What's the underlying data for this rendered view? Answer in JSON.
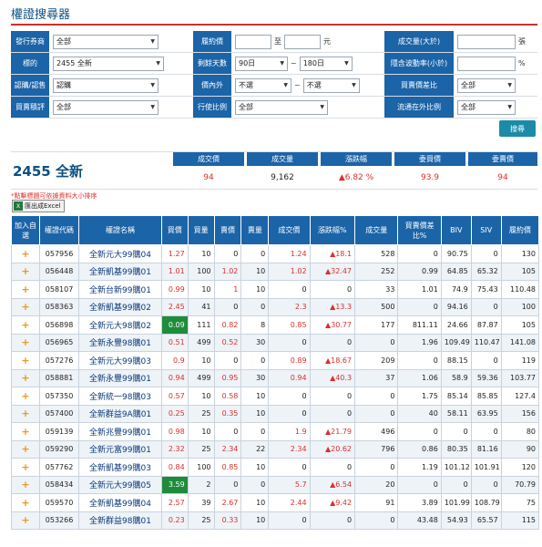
{
  "page_title": "權證搜尋器",
  "filters": {
    "issuer_label": "發行券商",
    "issuer_value": "全部",
    "strike_label": "履約價",
    "strike_to": "至",
    "strike_unit": "元",
    "volume_label": "成交量(大於)",
    "volume_unit": "張",
    "underlying_label": "標的",
    "underlying_value": "2455 全新",
    "days_label": "剩餘天數",
    "days_from": "90日",
    "days_sep": "~",
    "days_to": "180日",
    "iv_label": "隱含波動率(小於)",
    "iv_unit": "%",
    "type_label": "認購/認售",
    "type_value": "認購",
    "moneyness_label": "價內外",
    "moneyness_from": "不選",
    "moneyness_sep": "~",
    "moneyness_to": "不選",
    "spread_label": "買賣價差比",
    "spread_value": "全部",
    "rank_label": "買賣積評",
    "rank_value": "全部",
    "exercise_label": "行使比例",
    "exercise_value": "全部",
    "outstanding_label": "流通在外比例",
    "outstanding_value": "全部",
    "search_button": "搜尋"
  },
  "quote": {
    "name": "2455 全新",
    "headers": [
      "成交價",
      "成交量",
      "漲跌幅",
      "委買價",
      "委賣價"
    ],
    "values": [
      "94",
      "9,162",
      "▲6.82 %",
      "93.9",
      "94"
    ]
  },
  "hint": "*點擊標題可依據資料大小排序",
  "export_label": "匯出成Excel",
  "table": {
    "headers": [
      "加入自選",
      "權證代碼",
      "權證名稱",
      "買價",
      "買量",
      "賣價",
      "賣量",
      "成交價",
      "漲跌幅%",
      "成交量",
      "買賣價差比%",
      "BIV",
      "SIV",
      "履約價"
    ],
    "rows": [
      [
        "+",
        "057956",
        "全新元大99購04",
        "1.27",
        "10",
        "0",
        "0",
        "1.24",
        "▲18.1",
        "528",
        "0",
        "90.75",
        "0",
        "130"
      ],
      [
        "+",
        "056448",
        "全新凱基99購01",
        "1.01",
        "100",
        "1.02",
        "10",
        "1.02",
        "▲32.47",
        "252",
        "0.99",
        "64.85",
        "65.32",
        "105"
      ],
      [
        "+",
        "058107",
        "全新台新99購01",
        "0.99",
        "10",
        "1",
        "10",
        "0",
        "0",
        "33",
        "1.01",
        "74.9",
        "75.43",
        "110.48"
      ],
      [
        "+",
        "058363",
        "全新凱基99購02",
        "2.45",
        "41",
        "0",
        "0",
        "2.3",
        "▲13.3",
        "500",
        "0",
        "94.16",
        "0",
        "100"
      ],
      [
        "+",
        "056898",
        "全新元大98購02",
        "0.09",
        "111",
        "0.82",
        "8",
        "0.85",
        "▲30.77",
        "177",
        "811.11",
        "24.66",
        "87.87",
        "105"
      ],
      [
        "+",
        "056965",
        "全新永豐98購01",
        "0.51",
        "499",
        "0.52",
        "30",
        "0",
        "0",
        "0",
        "1.96",
        "109.49",
        "110.47",
        "141.08"
      ],
      [
        "+",
        "057276",
        "全新元大99購03",
        "0.9",
        "10",
        "0",
        "0",
        "0.89",
        "▲18.67",
        "209",
        "0",
        "88.15",
        "0",
        "119"
      ],
      [
        "+",
        "058881",
        "全新永豐99購01",
        "0.94",
        "499",
        "0.95",
        "30",
        "0.94",
        "▲40.3",
        "37",
        "1.06",
        "58.9",
        "59.36",
        "103.77"
      ],
      [
        "+",
        "057350",
        "全新統一98購03",
        "0.57",
        "10",
        "0.58",
        "10",
        "0",
        "0",
        "0",
        "1.75",
        "85.14",
        "85.85",
        "127.4"
      ],
      [
        "+",
        "057400",
        "全新群益9A購01",
        "0.25",
        "25",
        "0.35",
        "10",
        "0",
        "0",
        "0",
        "40",
        "58.11",
        "63.95",
        "156"
      ],
      [
        "+",
        "059139",
        "全新兆豐99購01",
        "0.98",
        "10",
        "0",
        "0",
        "1.9",
        "▲21.79",
        "496",
        "0",
        "0",
        "0",
        "80"
      ],
      [
        "+",
        "059290",
        "全新元富99購01",
        "2.32",
        "25",
        "2.34",
        "22",
        "2.34",
        "▲20.62",
        "796",
        "0.86",
        "80.35",
        "81.16",
        "90"
      ],
      [
        "+",
        "057762",
        "全新凱基99購03",
        "0.84",
        "100",
        "0.85",
        "10",
        "0",
        "0",
        "0",
        "1.19",
        "101.12",
        "101.91",
        "120"
      ],
      [
        "+",
        "058434",
        "全新元大99購05",
        "3.59",
        "2",
        "0",
        "0",
        "5.7",
        "▲6.54",
        "20",
        "0",
        "0",
        "0",
        "70.79"
      ],
      [
        "+",
        "059570",
        "全新凱基99購04",
        "2.57",
        "39",
        "2.67",
        "10",
        "2.44",
        "▲9.42",
        "91",
        "3.89",
        "101.99",
        "108.79",
        "75"
      ],
      [
        "+",
        "053266",
        "全新群益98購01",
        "0.23",
        "25",
        "0.33",
        "10",
        "0",
        "0",
        "0",
        "43.48",
        "54.93",
        "65.57",
        "115"
      ]
    ]
  },
  "colors": {
    "header_blue": "#1b64a8",
    "accent_red": "#c9302c",
    "highlight_green": "#1e8c3a",
    "title_blue": "#0b4f82"
  }
}
